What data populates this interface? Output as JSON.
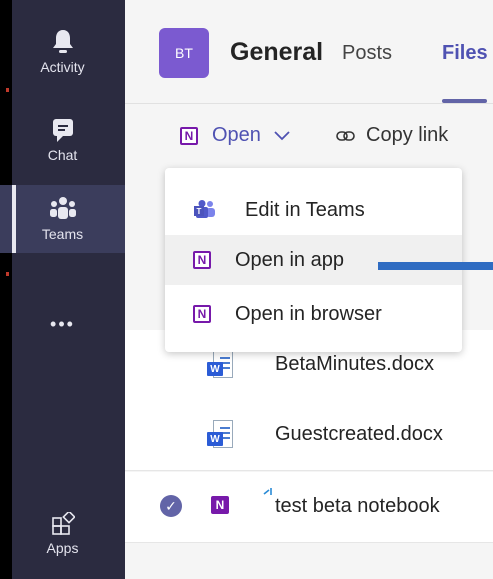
{
  "rail": {
    "items": [
      {
        "label": "Activity",
        "icon": "bell-icon"
      },
      {
        "label": "Chat",
        "icon": "chat-icon"
      },
      {
        "label": "Teams",
        "icon": "teams-icon"
      },
      {
        "label": "",
        "icon": "more-icon",
        "glyph": "•••"
      },
      {
        "label": "Apps",
        "icon": "apps-icon"
      }
    ]
  },
  "header": {
    "avatar": "BT",
    "title": "General",
    "tabs": [
      {
        "label": "Posts"
      },
      {
        "label": "Files"
      }
    ]
  },
  "toolbar": {
    "open_label": "Open",
    "copy_label": "Copy link"
  },
  "menu": {
    "items": [
      {
        "label": "Edit in Teams",
        "icon": "teams-icon"
      },
      {
        "label": "Open in app",
        "icon": "onenote-icon"
      },
      {
        "label": "Open in browser",
        "icon": "onenote-icon"
      }
    ]
  },
  "files": [
    {
      "name": "BetaMinutes.docx",
      "type": "word"
    },
    {
      "name": "Guestcreated.docx",
      "type": "word"
    },
    {
      "name": "test beta notebook",
      "type": "onenote",
      "selected": true
    }
  ],
  "colors": {
    "rail_bg": "#2b2b40",
    "accent": "#6264a7",
    "onenote": "#7719aa",
    "word": "#2b5cd6",
    "annotation_arrow": "#2f6cc2"
  }
}
